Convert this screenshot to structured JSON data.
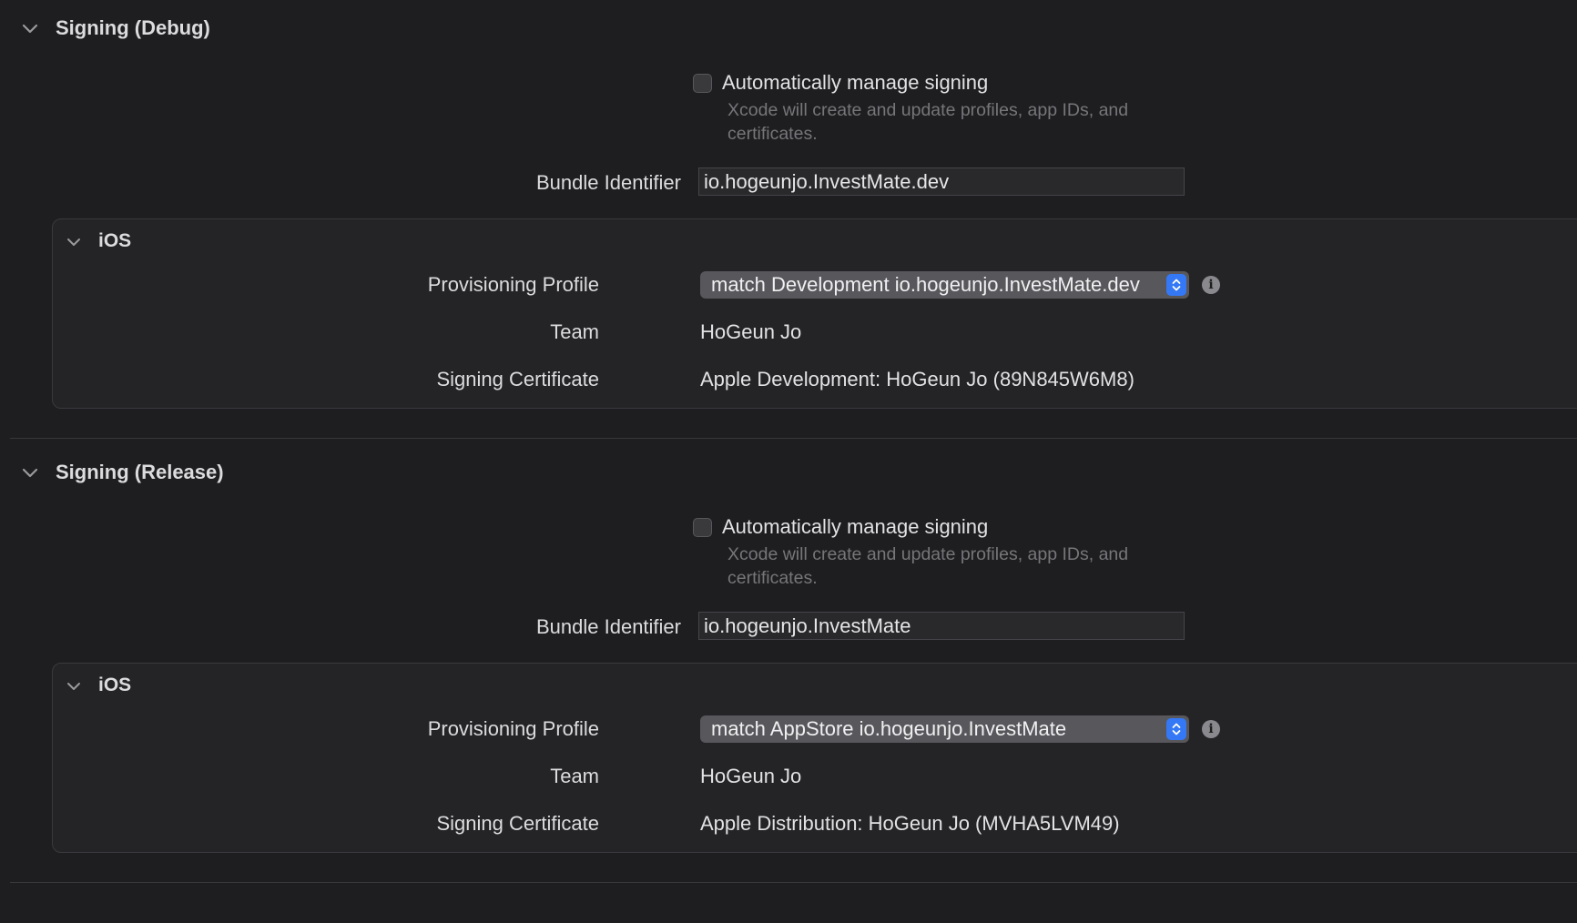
{
  "sections": [
    {
      "title": "Signing (Debug)",
      "auto_manage": {
        "label": "Automatically manage signing",
        "checked": false,
        "hint": "Xcode will create and update profiles, app IDs, and certificates."
      },
      "bundle_identifier": {
        "label": "Bundle Identifier",
        "value": "io.hogeunjo.InvestMate.dev"
      },
      "platform": {
        "title": "iOS",
        "provisioning_profile_label": "Provisioning Profile",
        "provisioning_profile_value": "match Development io.hogeunjo.InvestMate.dev",
        "team_label": "Team",
        "team_value": "HoGeun Jo",
        "certificate_label": "Signing Certificate",
        "certificate_value": "Apple Development: HoGeun Jo (89N845W6M8)"
      }
    },
    {
      "title": "Signing (Release)",
      "auto_manage": {
        "label": "Automatically manage signing",
        "checked": false,
        "hint": "Xcode will create and update profiles, app IDs, and certificates."
      },
      "bundle_identifier": {
        "label": "Bundle Identifier",
        "value": "io.hogeunjo.InvestMate"
      },
      "platform": {
        "title": "iOS",
        "provisioning_profile_label": "Provisioning Profile",
        "provisioning_profile_value": "match AppStore io.hogeunjo.InvestMate",
        "team_label": "Team",
        "team_value": "HoGeun Jo",
        "certificate_label": "Signing Certificate",
        "certificate_value": "Apple Distribution: HoGeun Jo (MVHA5LVM49)"
      }
    }
  ],
  "icons": {
    "disclosure": "chevron-down-icon",
    "stepper": "up-down-arrows-icon",
    "info": "info-icon"
  },
  "colors": {
    "background": "#1e1e20",
    "accent": "#3478f6",
    "group_background": "#242427"
  }
}
